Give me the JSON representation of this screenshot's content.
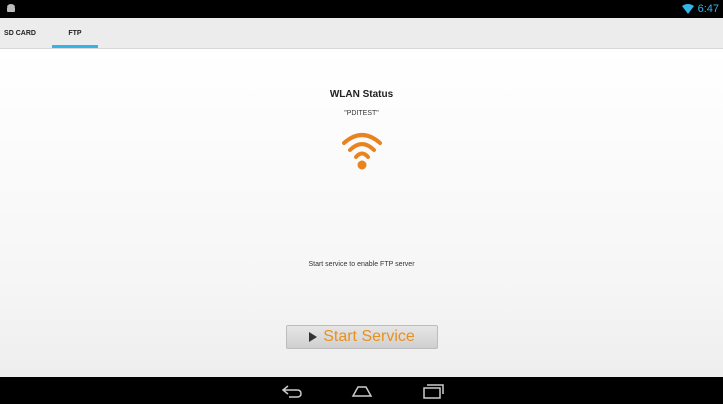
{
  "status_bar": {
    "time": "6:47",
    "left_icon": "android-icon",
    "wifi_icon": "wifi-signal-icon",
    "accent_color": "#33b5e5"
  },
  "tabs": [
    {
      "label": "SD CARD",
      "selected": false
    },
    {
      "label": "FTP",
      "selected": true
    }
  ],
  "main": {
    "title": "WLAN Status",
    "ssid": "\"PDITEST\"",
    "wifi_icon": "wifi-icon",
    "wifi_color": "#e8831e",
    "hint": "Start service to enable FTP server",
    "start_button": {
      "label": "Start Service",
      "icon": "play-icon",
      "text_color": "#e8901e"
    }
  },
  "nav_bar": {
    "back_icon": "back-icon",
    "home_icon": "home-icon",
    "recent_icon": "recent-apps-icon"
  }
}
